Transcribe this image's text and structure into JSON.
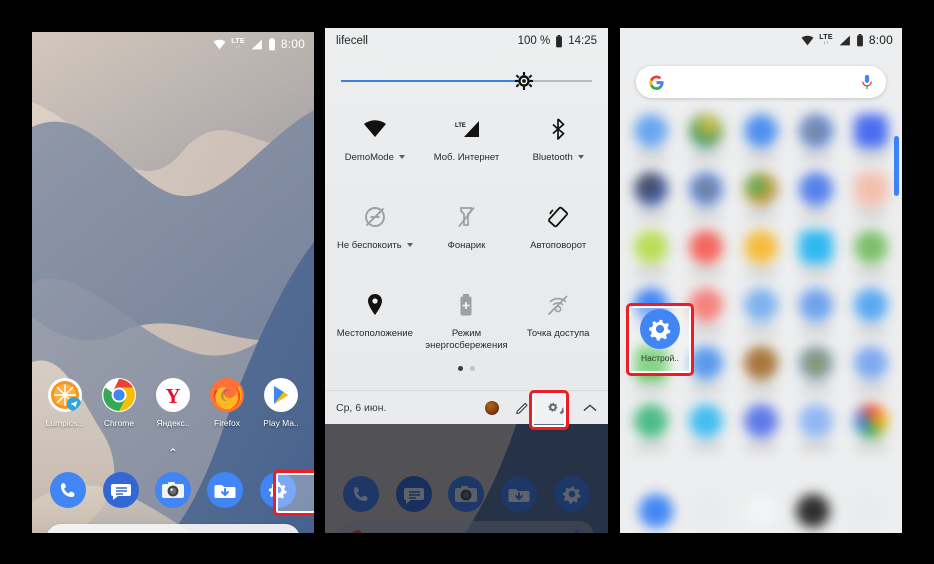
{
  "phone1": {
    "name": "home-screen",
    "status_bar": {
      "wifi": "wifi-icon",
      "network_type": "LTE",
      "data_arrows": "↓↑",
      "signal": "signal-icon",
      "battery": "battery-icon",
      "clock": "8:00"
    },
    "apps": [
      {
        "label": "Lumpics:..",
        "icon": "lumpics-icon"
      },
      {
        "label": "Chrome",
        "icon": "chrome-icon"
      },
      {
        "label": "Яндекс..",
        "icon": "yandex-icon"
      },
      {
        "label": "Firefox",
        "icon": "firefox-icon"
      },
      {
        "label": "Play Ma..",
        "icon": "play-market-icon"
      }
    ],
    "drawer_handle": "⌃",
    "dock": [
      {
        "label": "Телефон",
        "icon": "phone-icon"
      },
      {
        "label": "Сообщения",
        "icon": "messages-icon"
      },
      {
        "label": "Камера",
        "icon": "camera-icon"
      },
      {
        "label": "Загрузки",
        "icon": "downloads-icon"
      },
      {
        "label": "Настройки",
        "icon": "settings-gear-icon"
      }
    ],
    "search": {
      "logo": "google-g-icon",
      "mic": "microphone-icon",
      "placeholder": ""
    },
    "highlight": "settings-dock-icon"
  },
  "phone2": {
    "name": "quick-settings-panel",
    "status_bar": {
      "carrier": "lifecell",
      "battery_percent": "100 %",
      "battery": "battery-icon",
      "clock": "14:25"
    },
    "brightness": {
      "label": "brightness-slider",
      "value": 73,
      "thumb_icon": "brightness-sun-icon"
    },
    "tiles": [
      {
        "label": "DemoMode",
        "icon": "wifi-icon",
        "has_caret": true
      },
      {
        "label": "Моб. Интернет",
        "icon": "mobile-data-icon",
        "has_caret": false
      },
      {
        "label": "Bluetooth",
        "icon": "bluetooth-icon",
        "has_caret": true
      },
      {
        "label": "Не беспокоить",
        "icon": "do-not-disturb-icon",
        "has_caret": true
      },
      {
        "label": "Фонарик",
        "icon": "flashlight-off-icon",
        "has_caret": false
      },
      {
        "label": "Автоповорот",
        "icon": "auto-rotate-icon",
        "has_caret": false
      },
      {
        "label": "Местоположение",
        "icon": "location-pin-icon",
        "has_caret": false
      },
      {
        "label": "Режим энергосбережения",
        "icon": "battery-saver-icon",
        "has_caret": false
      },
      {
        "label": "Точка доступа",
        "icon": "hotspot-off-icon",
        "has_caret": false
      }
    ],
    "pager": {
      "pages": 2,
      "active": 1
    },
    "footer": {
      "date": "Ср, 6 июн.",
      "avatar": "user-avatar",
      "edit": "pencil-edit-icon",
      "settings": "settings-gear-wrench-icon",
      "collapse": "chevron-up-icon"
    },
    "highlight": "quick-settings-gear-icon",
    "dock": [
      {
        "label": "Телефон",
        "icon": "phone-icon"
      },
      {
        "label": "Сообщения",
        "icon": "messages-icon"
      },
      {
        "label": "Камера",
        "icon": "camera-icon"
      },
      {
        "label": "Загрузки",
        "icon": "downloads-icon"
      },
      {
        "label": "Настройки",
        "icon": "settings-gear-icon"
      }
    ],
    "search": {
      "logo": "google-g-icon",
      "mic": "microphone-icon"
    }
  },
  "phone3": {
    "name": "app-drawer",
    "status_bar": {
      "wifi": "wifi-icon",
      "network_type": "LTE",
      "data_arrows": "↓↑",
      "signal": "signal-icon",
      "battery": "battery-icon",
      "clock": "8:00"
    },
    "search": {
      "logo": "google-g-icon",
      "mic": "microphone-icon",
      "placeholder": ""
    },
    "scrollbar": "drawer-scrollbar",
    "settings_app": {
      "label": "Настрой..",
      "icon": "settings-gear-icon"
    },
    "highlight": "settings-app-icon"
  },
  "colors": {
    "highlight_red": "#ee1c25",
    "android_blue": "#4285f4",
    "slider_blue": "#3f7fe0",
    "scrollbar_blue": "#3b82f6",
    "background": "#000000"
  }
}
